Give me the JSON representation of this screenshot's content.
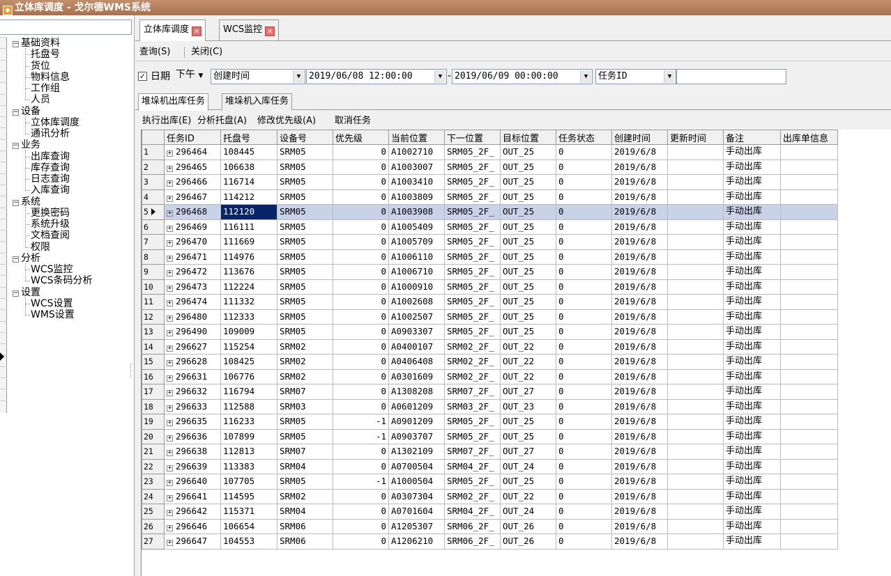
{
  "window": {
    "title": "立体库调度 - 戈尔德WMS系统"
  },
  "tree": {
    "groups": [
      {
        "label": "基础资料",
        "items": [
          "托盘号",
          "货位",
          "物料信息",
          "工作组",
          "人员"
        ]
      },
      {
        "label": "设备",
        "items": [
          "立体库调度",
          "通讯分析"
        ]
      },
      {
        "label": "业务",
        "items": [
          "出库查询",
          "库存查询",
          "日志查询",
          "入库查询"
        ]
      },
      {
        "label": "系统",
        "items": [
          "更换密码",
          "系统升级",
          "文档查阅",
          "权限"
        ]
      },
      {
        "label": "分析",
        "items": [
          "WCS监控",
          "WCS条码分析"
        ]
      },
      {
        "label": "设置",
        "items": [
          "WCS设置",
          "WMS设置"
        ]
      }
    ]
  },
  "doc_tabs": [
    {
      "label": "立体库调度",
      "active": true
    },
    {
      "label": "WCS监控",
      "active": false
    }
  ],
  "menu": {
    "query": "查询(S)",
    "close": "关闭(C)"
  },
  "filter": {
    "date_checked": true,
    "date_label": "日期",
    "period": "下午",
    "time_field": "创建时间",
    "start": "2019/06/08 12:00:00",
    "range_sep": "-",
    "end": "2019/06/09 00:00:00",
    "search_field": "任务ID",
    "search_value": ""
  },
  "sub_tabs": [
    {
      "label": "堆垛机出库任务",
      "active": true
    },
    {
      "label": "堆垛机入库任务",
      "active": false
    }
  ],
  "actions": [
    "执行出库(E)",
    "分析托盘(A)",
    "修改优先级(A)",
    "取消任务"
  ],
  "grid": {
    "columns": [
      "任务ID",
      "托盘号",
      "设备号",
      "优先级",
      "当前位置",
      "下一位置",
      "目标位置",
      "任务状态",
      "创建时间",
      "更新时间",
      "备注",
      "出库单信息"
    ],
    "selected_row": 5,
    "rows": [
      {
        "n": "1",
        "id": "296464",
        "pallet": "108445",
        "dev": "SRM05",
        "pri": "0",
        "cur": "A1002710",
        "next": "SRM05_2F_",
        "target": "OUT_25",
        "status": "0",
        "created": "2019/6/8",
        "updated": "",
        "note": "手动出库",
        "order": ""
      },
      {
        "n": "2",
        "id": "296465",
        "pallet": "106638",
        "dev": "SRM05",
        "pri": "0",
        "cur": "A1003007",
        "next": "SRM05_2F_",
        "target": "OUT_25",
        "status": "0",
        "created": "2019/6/8",
        "updated": "",
        "note": "手动出库",
        "order": ""
      },
      {
        "n": "3",
        "id": "296466",
        "pallet": "116714",
        "dev": "SRM05",
        "pri": "0",
        "cur": "A1003410",
        "next": "SRM05_2F_",
        "target": "OUT_25",
        "status": "0",
        "created": "2019/6/8",
        "updated": "",
        "note": "手动出库",
        "order": ""
      },
      {
        "n": "4",
        "id": "296467",
        "pallet": "114212",
        "dev": "SRM05",
        "pri": "0",
        "cur": "A1003809",
        "next": "SRM05_2F_",
        "target": "OUT_25",
        "status": "0",
        "created": "2019/6/8",
        "updated": "",
        "note": "手动出库",
        "order": ""
      },
      {
        "n": "5",
        "id": "296468",
        "pallet": "112120",
        "dev": "SRM05",
        "pri": "0",
        "cur": "A1003908",
        "next": "SRM05_2F_",
        "target": "OUT_25",
        "status": "0",
        "created": "2019/6/8",
        "updated": "",
        "note": "手动出库",
        "order": ""
      },
      {
        "n": "6",
        "id": "296469",
        "pallet": "116111",
        "dev": "SRM05",
        "pri": "0",
        "cur": "A1005409",
        "next": "SRM05_2F_",
        "target": "OUT_25",
        "status": "0",
        "created": "2019/6/8",
        "updated": "",
        "note": "手动出库",
        "order": ""
      },
      {
        "n": "7",
        "id": "296470",
        "pallet": "111669",
        "dev": "SRM05",
        "pri": "0",
        "cur": "A1005709",
        "next": "SRM05_2F_",
        "target": "OUT_25",
        "status": "0",
        "created": "2019/6/8",
        "updated": "",
        "note": "手动出库",
        "order": ""
      },
      {
        "n": "8",
        "id": "296471",
        "pallet": "114976",
        "dev": "SRM05",
        "pri": "0",
        "cur": "A1006110",
        "next": "SRM05_2F_",
        "target": "OUT_25",
        "status": "0",
        "created": "2019/6/8",
        "updated": "",
        "note": "手动出库",
        "order": ""
      },
      {
        "n": "9",
        "id": "296472",
        "pallet": "113676",
        "dev": "SRM05",
        "pri": "0",
        "cur": "A1006710",
        "next": "SRM05_2F_",
        "target": "OUT_25",
        "status": "0",
        "created": "2019/6/8",
        "updated": "",
        "note": "手动出库",
        "order": ""
      },
      {
        "n": "10",
        "id": "296473",
        "pallet": "112224",
        "dev": "SRM05",
        "pri": "0",
        "cur": "A1000910",
        "next": "SRM05_2F_",
        "target": "OUT_25",
        "status": "0",
        "created": "2019/6/8",
        "updated": "",
        "note": "手动出库",
        "order": ""
      },
      {
        "n": "11",
        "id": "296474",
        "pallet": "111332",
        "dev": "SRM05",
        "pri": "0",
        "cur": "A1002608",
        "next": "SRM05_2F_",
        "target": "OUT_25",
        "status": "0",
        "created": "2019/6/8",
        "updated": "",
        "note": "手动出库",
        "order": ""
      },
      {
        "n": "12",
        "id": "296480",
        "pallet": "112333",
        "dev": "SRM05",
        "pri": "0",
        "cur": "A1002507",
        "next": "SRM05_2F_",
        "target": "OUT_25",
        "status": "0",
        "created": "2019/6/8",
        "updated": "",
        "note": "手动出库",
        "order": ""
      },
      {
        "n": "13",
        "id": "296490",
        "pallet": "109009",
        "dev": "SRM05",
        "pri": "0",
        "cur": "A0903307",
        "next": "SRM05_2F_",
        "target": "OUT_25",
        "status": "0",
        "created": "2019/6/8",
        "updated": "",
        "note": "手动出库",
        "order": ""
      },
      {
        "n": "14",
        "id": "296627",
        "pallet": "115254",
        "dev": "SRM02",
        "pri": "0",
        "cur": "A0400107",
        "next": "SRM02_2F_",
        "target": "OUT_22",
        "status": "0",
        "created": "2019/6/8",
        "updated": "",
        "note": "手动出库",
        "order": ""
      },
      {
        "n": "15",
        "id": "296628",
        "pallet": "108425",
        "dev": "SRM02",
        "pri": "0",
        "cur": "A0406408",
        "next": "SRM02_2F_",
        "target": "OUT_22",
        "status": "0",
        "created": "2019/6/8",
        "updated": "",
        "note": "手动出库",
        "order": ""
      },
      {
        "n": "16",
        "id": "296631",
        "pallet": "106776",
        "dev": "SRM02",
        "pri": "0",
        "cur": "A0301609",
        "next": "SRM02_2F_",
        "target": "OUT_22",
        "status": "0",
        "created": "2019/6/8",
        "updated": "",
        "note": "手动出库",
        "order": ""
      },
      {
        "n": "17",
        "id": "296632",
        "pallet": "116794",
        "dev": "SRM07",
        "pri": "0",
        "cur": "A1308208",
        "next": "SRM07_2F_",
        "target": "OUT_27",
        "status": "0",
        "created": "2019/6/8",
        "updated": "",
        "note": "手动出库",
        "order": ""
      },
      {
        "n": "18",
        "id": "296633",
        "pallet": "112588",
        "dev": "SRM03",
        "pri": "0",
        "cur": "A0601209",
        "next": "SRM03_2F_",
        "target": "OUT_23",
        "status": "0",
        "created": "2019/6/8",
        "updated": "",
        "note": "手动出库",
        "order": ""
      },
      {
        "n": "19",
        "id": "296635",
        "pallet": "116233",
        "dev": "SRM05",
        "pri": "-1",
        "cur": "A0901209",
        "next": "SRM05_2F_",
        "target": "OUT_25",
        "status": "0",
        "created": "2019/6/8",
        "updated": "",
        "note": "手动出库",
        "order": ""
      },
      {
        "n": "20",
        "id": "296636",
        "pallet": "107899",
        "dev": "SRM05",
        "pri": "-1",
        "cur": "A0903707",
        "next": "SRM05_2F_",
        "target": "OUT_25",
        "status": "0",
        "created": "2019/6/8",
        "updated": "",
        "note": "手动出库",
        "order": ""
      },
      {
        "n": "21",
        "id": "296638",
        "pallet": "112813",
        "dev": "SRM07",
        "pri": "0",
        "cur": "A1302109",
        "next": "SRM07_2F_",
        "target": "OUT_27",
        "status": "0",
        "created": "2019/6/8",
        "updated": "",
        "note": "手动出库",
        "order": ""
      },
      {
        "n": "22",
        "id": "296639",
        "pallet": "113383",
        "dev": "SRM04",
        "pri": "0",
        "cur": "A0700504",
        "next": "SRM04_2F_",
        "target": "OUT_24",
        "status": "0",
        "created": "2019/6/8",
        "updated": "",
        "note": "手动出库",
        "order": ""
      },
      {
        "n": "23",
        "id": "296640",
        "pallet": "107705",
        "dev": "SRM05",
        "pri": "-1",
        "cur": "A1000504",
        "next": "SRM05_2F_",
        "target": "OUT_25",
        "status": "0",
        "created": "2019/6/8",
        "updated": "",
        "note": "手动出库",
        "order": ""
      },
      {
        "n": "24",
        "id": "296641",
        "pallet": "114595",
        "dev": "SRM02",
        "pri": "0",
        "cur": "A0307304",
        "next": "SRM02_2F_",
        "target": "OUT_22",
        "status": "0",
        "created": "2019/6/8",
        "updated": "",
        "note": "手动出库",
        "order": ""
      },
      {
        "n": "25",
        "id": "296642",
        "pallet": "115371",
        "dev": "SRM04",
        "pri": "0",
        "cur": "A0701604",
        "next": "SRM04_2F_",
        "target": "OUT_24",
        "status": "0",
        "created": "2019/6/8",
        "updated": "",
        "note": "手动出库",
        "order": ""
      },
      {
        "n": "26",
        "id": "296646",
        "pallet": "106654",
        "dev": "SRM06",
        "pri": "0",
        "cur": "A1205307",
        "next": "SRM06_2F_",
        "target": "OUT_26",
        "status": "0",
        "created": "2019/6/8",
        "updated": "",
        "note": "手动出库",
        "order": ""
      },
      {
        "n": "27",
        "id": "296647",
        "pallet": "104553",
        "dev": "SRM06",
        "pri": "0",
        "cur": "A1206210",
        "next": "SRM06_2F_",
        "target": "OUT_26",
        "status": "0",
        "created": "2019/6/8",
        "updated": "",
        "note": "手动出库",
        "order": ""
      }
    ]
  },
  "colors": {
    "title_bar": "#b07a56",
    "selection": "#c8d3e8",
    "focus_cell": "#0a246a"
  }
}
